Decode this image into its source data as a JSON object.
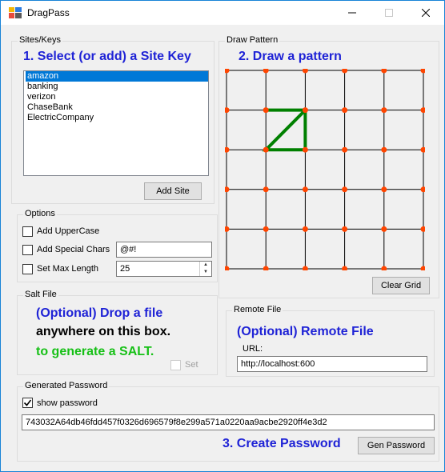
{
  "window": {
    "title": "DragPass"
  },
  "sites": {
    "group_label": "Sites/Keys",
    "heading": "1. Select (or add) a Site Key",
    "items": [
      "amazon",
      "banking",
      "verizon",
      "ChaseBank",
      "ElectricCompany"
    ],
    "selected_index": 0,
    "add_button": "Add Site"
  },
  "pattern": {
    "group_label": "Draw Pattern",
    "heading": "2. Draw a pattern",
    "grid_cols": 6,
    "grid_rows": 6,
    "path": [
      [
        1,
        1
      ],
      [
        2,
        1
      ],
      [
        2,
        2
      ],
      [
        1,
        2
      ],
      [
        2,
        1
      ]
    ],
    "dot_color": "#ff4500",
    "line_color": "#008000",
    "clear_button": "Clear Grid"
  },
  "options": {
    "group_label": "Options",
    "uppercase_label": "Add UpperCase",
    "uppercase_checked": false,
    "special_label": "Add Special Chars",
    "special_checked": false,
    "special_value": "@#!",
    "maxlen_label": "Set Max Length",
    "maxlen_checked": false,
    "maxlen_value": "25"
  },
  "salt": {
    "group_label": "Salt File",
    "line1": "(Optional) Drop a file",
    "line2": "anywhere on this box.",
    "line3": "to generate a SALT.",
    "set_label": "Set",
    "set_checked": false
  },
  "remote": {
    "group_label": "Remote File",
    "heading": "(Optional) Remote File",
    "url_label": "URL:",
    "url_value": "http://localhost:600"
  },
  "generated": {
    "group_label": "Generated Password",
    "show_label": "show password",
    "show_checked": true,
    "password": "743032A64db46fdd457f0326d696579f8e299a571a0220aa9acbe2920ff4e3d2",
    "create_heading": "3. Create Password",
    "gen_button": "Gen Password"
  }
}
